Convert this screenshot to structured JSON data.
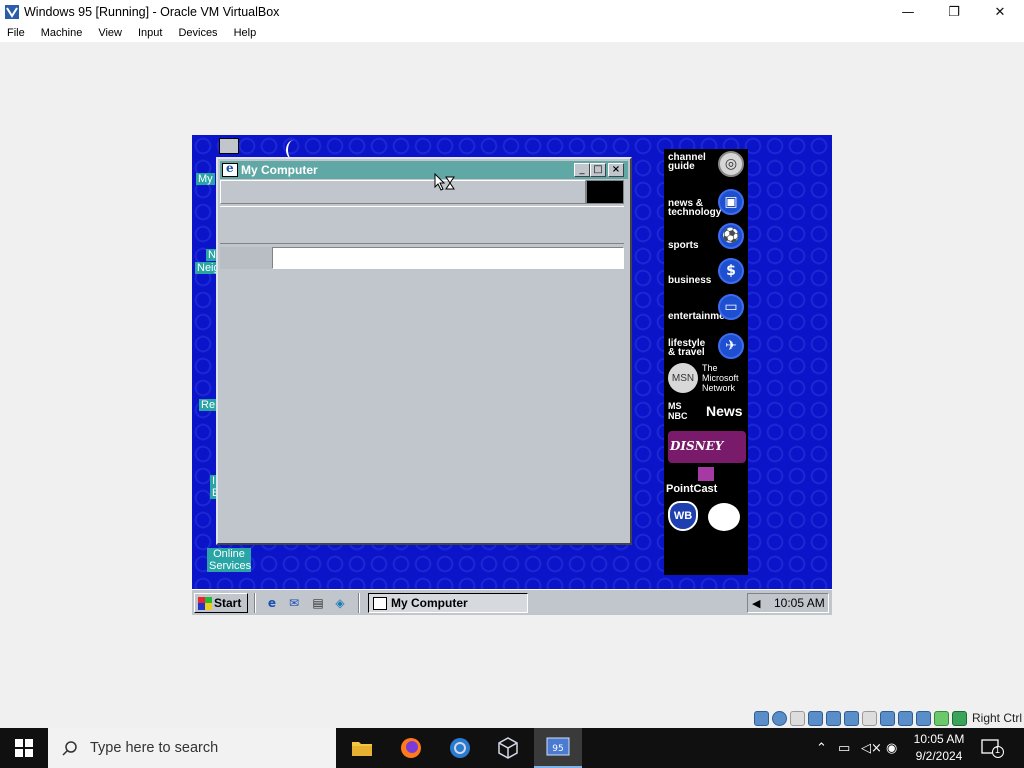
{
  "host": {
    "title": "Windows 95 [Running] - Oracle VM VirtualBox",
    "menu": [
      "File",
      "Machine",
      "View",
      "Input",
      "Devices",
      "Help"
    ],
    "controls": {
      "minimize": "—",
      "restore": "❐",
      "close": "✕"
    },
    "status_right_label": "Right Ctrl"
  },
  "guest": {
    "desktop_labels": [
      "My",
      "N",
      "Neig",
      "Re",
      "I",
      "E"
    ],
    "online_services": "Online\nServices",
    "window": {
      "title": "My Computer",
      "buttons": {
        "minimize": "_",
        "maximize": "□",
        "close": "×"
      }
    },
    "channel_bar": {
      "items": [
        {
          "label": "channel guide",
          "icon": "globe-icon"
        },
        {
          "label": "news & technology",
          "icon": "computer-icon"
        },
        {
          "label": "sports",
          "icon": "ball-icon"
        },
        {
          "label": "business",
          "icon": "dollar-icon"
        },
        {
          "label": "entertainment",
          "icon": "screen-icon"
        },
        {
          "label": "lifestyle & travel",
          "icon": "plane-icon"
        }
      ],
      "msn_logo": "MSN",
      "msn_text": "The Microsoft Network",
      "msnbc_text": "News",
      "msnbc_logo": "MS NBC",
      "disney_logo": "DISNEY",
      "pointcast": "PointCast",
      "wb_logo": "WB"
    },
    "taskbar": {
      "start_label": "Start",
      "task_label": "My Computer",
      "clock": "10:05 AM"
    }
  },
  "win10": {
    "search_placeholder": "Type here to search",
    "clock_time": "10:05 AM",
    "clock_date": "9/2/2024",
    "notification_count": "1"
  }
}
